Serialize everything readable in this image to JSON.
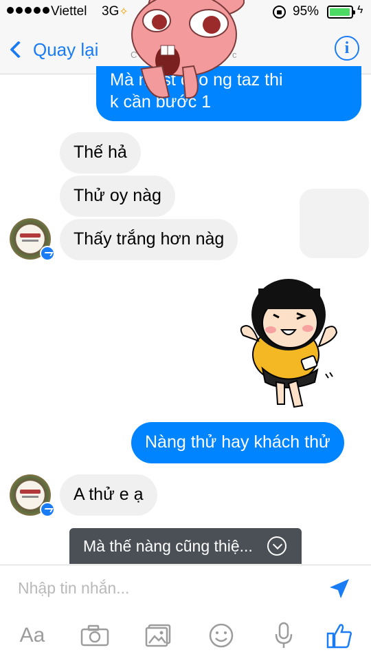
{
  "status_bar": {
    "carrier": "Viettel",
    "network": "3G",
    "battery_percent": "95%",
    "battery_level": 0.95,
    "signal_bars": 5
  },
  "nav": {
    "back_label": "Quay lại",
    "title_left": "C",
    "title_right": "c"
  },
  "messages": {
    "top_line1": "Mà ng        st cho ng taz thi",
    "top_line2": "k cần bước 1",
    "m1": "Thế hả",
    "m2": "Thử oy nàg",
    "m3": "Thấy trắng hơn nàg",
    "m4": "Nàng thử hay khách thử",
    "m5": "A thử e ạ"
  },
  "preview": {
    "text": "Mà thế nàng cũng thiệ..."
  },
  "composer": {
    "placeholder": "Nhập tin nhắn...",
    "aa_label": "Aa"
  },
  "colors": {
    "accent": "#1a7cf5",
    "outgoing_bubble": "#0084ff",
    "incoming_bubble": "#f1f0f0",
    "battery": "#4cd964"
  },
  "icons": [
    "signal-dots-icon",
    "lock-rotation-icon",
    "battery-icon",
    "charging-icon",
    "back-chevron-icon",
    "info-icon",
    "messenger-badge-icon",
    "chevron-down-icon",
    "send-icon",
    "camera-icon",
    "photo-icon",
    "emoji-icon",
    "microphone-icon",
    "thumbs-up-icon"
  ]
}
